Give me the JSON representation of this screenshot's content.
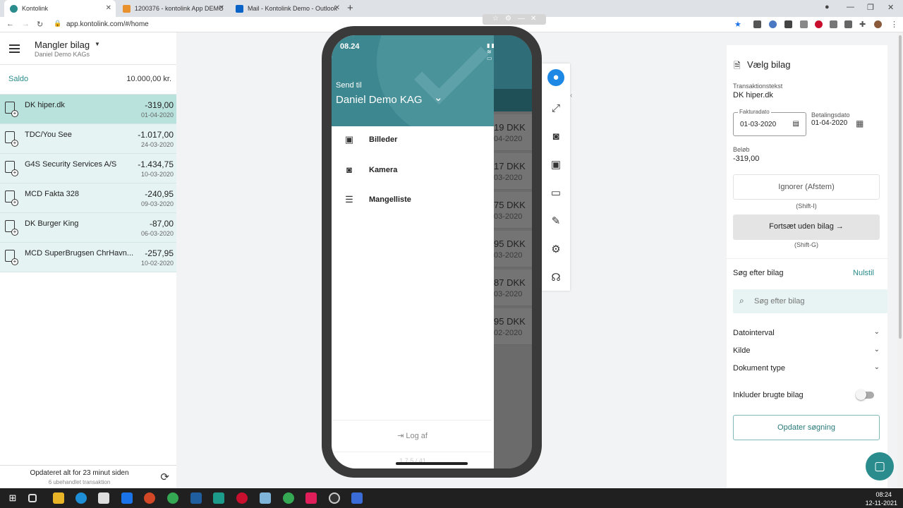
{
  "browser": {
    "tabs": [
      {
        "title": "Kontolink",
        "color": "#2a8c8c"
      },
      {
        "title": "1200376 - kontolink App DEMO",
        "color": "#e8912d"
      },
      {
        "title": "Mail - Kontolink Demo - Outlook",
        "color": "#0a64c8"
      }
    ],
    "url": "app.kontolink.com/#/home"
  },
  "left_panel": {
    "title": "Mangler bilag",
    "subtitle": "Daniel Demo KAGs",
    "saldo_label": "Saldo",
    "saldo_value": "10.000,00 kr.",
    "transactions": [
      {
        "name": "DK hiper.dk",
        "amount": "-319,00",
        "date": "01-04-2020"
      },
      {
        "name": "TDC/You See",
        "amount": "-1.017,00",
        "date": "24-03-2020"
      },
      {
        "name": "G4S Security Services A/S",
        "amount": "-1.434,75",
        "date": "10-03-2020"
      },
      {
        "name": "MCD Fakta 328",
        "amount": "-240,95",
        "date": "09-03-2020"
      },
      {
        "name": "DK Burger King",
        "amount": "-87,00",
        "date": "06-03-2020"
      },
      {
        "name": "MCD SuperBrugsen ChrHavn...",
        "amount": "-257,95",
        "date": "10-02-2020"
      }
    ],
    "footer_main": "Opdateret alt for 23 minut siden",
    "footer_sub": "6 ubehandlet transaktion"
  },
  "phone": {
    "time": "08.24",
    "send_to_label": "Send til",
    "send_to_name": "Daniel Demo KAG",
    "menu": [
      {
        "label": "Billeder",
        "icon": "images-icon"
      },
      {
        "label": "Kamera",
        "icon": "camera-icon"
      },
      {
        "label": "Mangelliste",
        "icon": "list-icon"
      }
    ],
    "logout": "Log af",
    "version": "1.7.5 / 41",
    "behind_rows": [
      {
        "amount": "19 DKK",
        "date": "04-2020"
      },
      {
        "amount": "17 DKK",
        "date": "03-2020"
      },
      {
        "amount": "75 DKK",
        "date": "03-2020"
      },
      {
        "amount": "95 DKK",
        "date": "03-2020"
      },
      {
        "amount": "87 DKK",
        "date": "03-2020"
      },
      {
        "amount": "95 DKK",
        "date": "02-2020"
      }
    ]
  },
  "right_panel": {
    "title": "Vælg bilag",
    "trans_label": "Transaktionstekst",
    "trans_value": "DK hiper.dk",
    "faktura_label": "Fakturadato",
    "faktura_value": "01-03-2020",
    "betaling_label": "Betalingsdato",
    "betaling_value": "01-04-2020",
    "amount_label": "Beløb",
    "amount_value": "-319,00",
    "ignore_button": "Ignorer (Afstem)",
    "ignore_shortcut": "(Shift-I)",
    "continue_button": "Fortsæt uden bilag →",
    "continue_shortcut": "(Shift-G)",
    "search_title": "Søg efter bilag",
    "reset": "Nulstil",
    "search_placeholder": "Søg efter bilag",
    "filters": [
      "Datointerval",
      "Kilde",
      "Dokument type"
    ],
    "include_used": "Inkluder brugte bilag",
    "update_button": "Opdater søgning"
  },
  "taskbar": {
    "time": "08:24",
    "date": "12-11-2021"
  }
}
